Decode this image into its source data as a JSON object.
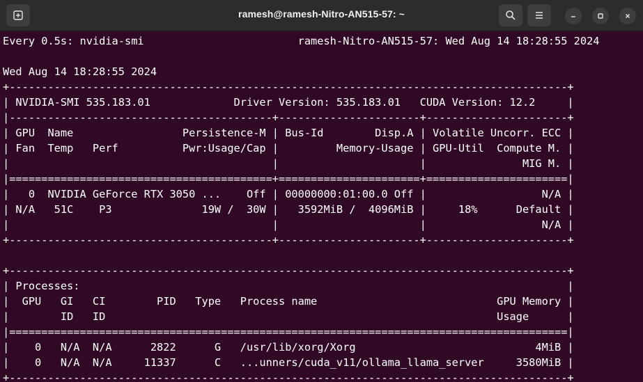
{
  "window": {
    "title": "ramesh@ramesh-Nitro-AN515-57: ~",
    "buttons": {
      "new_tab_icon": "new-tab-icon",
      "search_icon": "search-icon",
      "menu_icon": "hamburger-menu-icon",
      "minimize_icon": "minimize-icon",
      "maximize_icon": "maximize-icon",
      "close_icon": "close-icon"
    },
    "colors": {
      "titlebar": "#2c2c2c",
      "terminal_bg": "#300a24",
      "text": "#ffffff"
    }
  },
  "terminal": {
    "lines": [
      "Every 0.5s: nvidia-smi                        ramesh-Nitro-AN515-57: Wed Aug 14 18:28:55 2024",
      "",
      "Wed Aug 14 18:28:55 2024",
      "+---------------------------------------------------------------------------------------+",
      "| NVIDIA-SMI 535.183.01             Driver Version: 535.183.01   CUDA Version: 12.2     |",
      "|-----------------------------------------+----------------------+----------------------+",
      "| GPU  Name                 Persistence-M | Bus-Id        Disp.A | Volatile Uncorr. ECC |",
      "| Fan  Temp   Perf          Pwr:Usage/Cap |         Memory-Usage | GPU-Util  Compute M. |",
      "|                                         |                      |               MIG M. |",
      "|=========================================+======================+======================|",
      "|   0  NVIDIA GeForce RTX 3050 ...    Off | 00000000:01:00.0 Off |                  N/A |",
      "| N/A   51C    P3              19W /  30W |   3592MiB /  4096MiB |     18%      Default |",
      "|                                         |                      |                  N/A |",
      "+-----------------------------------------+----------------------+----------------------+",
      "",
      "+---------------------------------------------------------------------------------------+",
      "| Processes:                                                                            |",
      "|  GPU   GI   CI        PID   Type   Process name                            GPU Memory |",
      "|        ID   ID                                                             Usage      |",
      "|=======================================================================================|",
      "|    0   N/A  N/A      2822      G   /usr/lib/xorg/Xorg                            4MiB |",
      "|    0   N/A  N/A     11337      C   ...unners/cuda_v11/ollama_llama_server     3580MiB |",
      "+---------------------------------------------------------------------------------------+"
    ]
  }
}
